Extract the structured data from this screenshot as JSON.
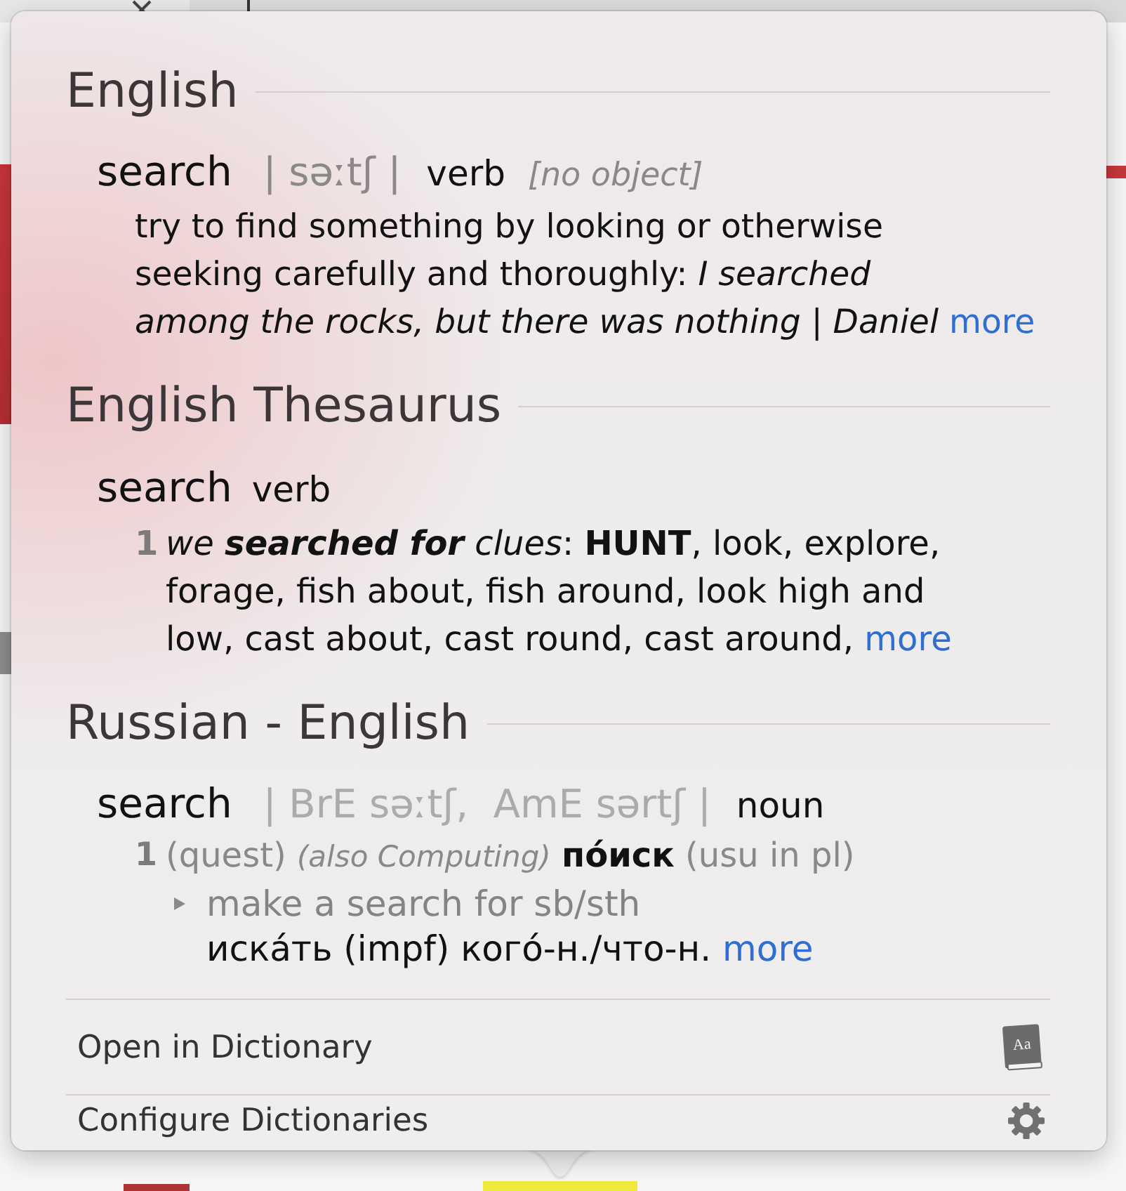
{
  "sections": [
    {
      "kind": "definition",
      "title": "English",
      "headword": "search",
      "pronunciation": "| səːtʃ |",
      "part_of_speech": "verb",
      "grammar": "[no object]",
      "definition": "try to find something by looking or otherwise\nseeking carefully and thoroughly: *I searched*\n*among the rocks, but there was nothing* | *Daniel*",
      "more": "more"
    },
    {
      "kind": "thesaurus",
      "title": "English Thesaurus",
      "headword": "search",
      "part_of_speech": "verb",
      "senses": [
        {
          "number": "1",
          "example": "we **searched for** clues",
          "text": ": **HUNT**, look, explore, forage, fish about, fish around, look high and low, cast about, cast round, cast around,",
          "more": "more"
        }
      ]
    },
    {
      "kind": "bilingual",
      "title": "Russian - English",
      "headword": "search",
      "pronunciation": "| BrE səːtʃ,  AmE sərtʃ |",
      "part_of_speech": "noun",
      "senses": [
        {
          "number": "1",
          "text": "(quest) *(also Computing)* **по́иск** (usu in pl)",
          "subsenses": [
            {
              "phrase": "make a search for sb/sth",
              "translation": "иска́ть (impf) кого́-н./что-н.",
              "more": "more"
            }
          ]
        }
      ]
    }
  ],
  "footer": [
    {
      "kind": "dictionary",
      "label": "Open in Dictionary",
      "icon_text": "Aa"
    },
    {
      "kind": "settings",
      "label": "Configure Dictionaries"
    }
  ]
}
